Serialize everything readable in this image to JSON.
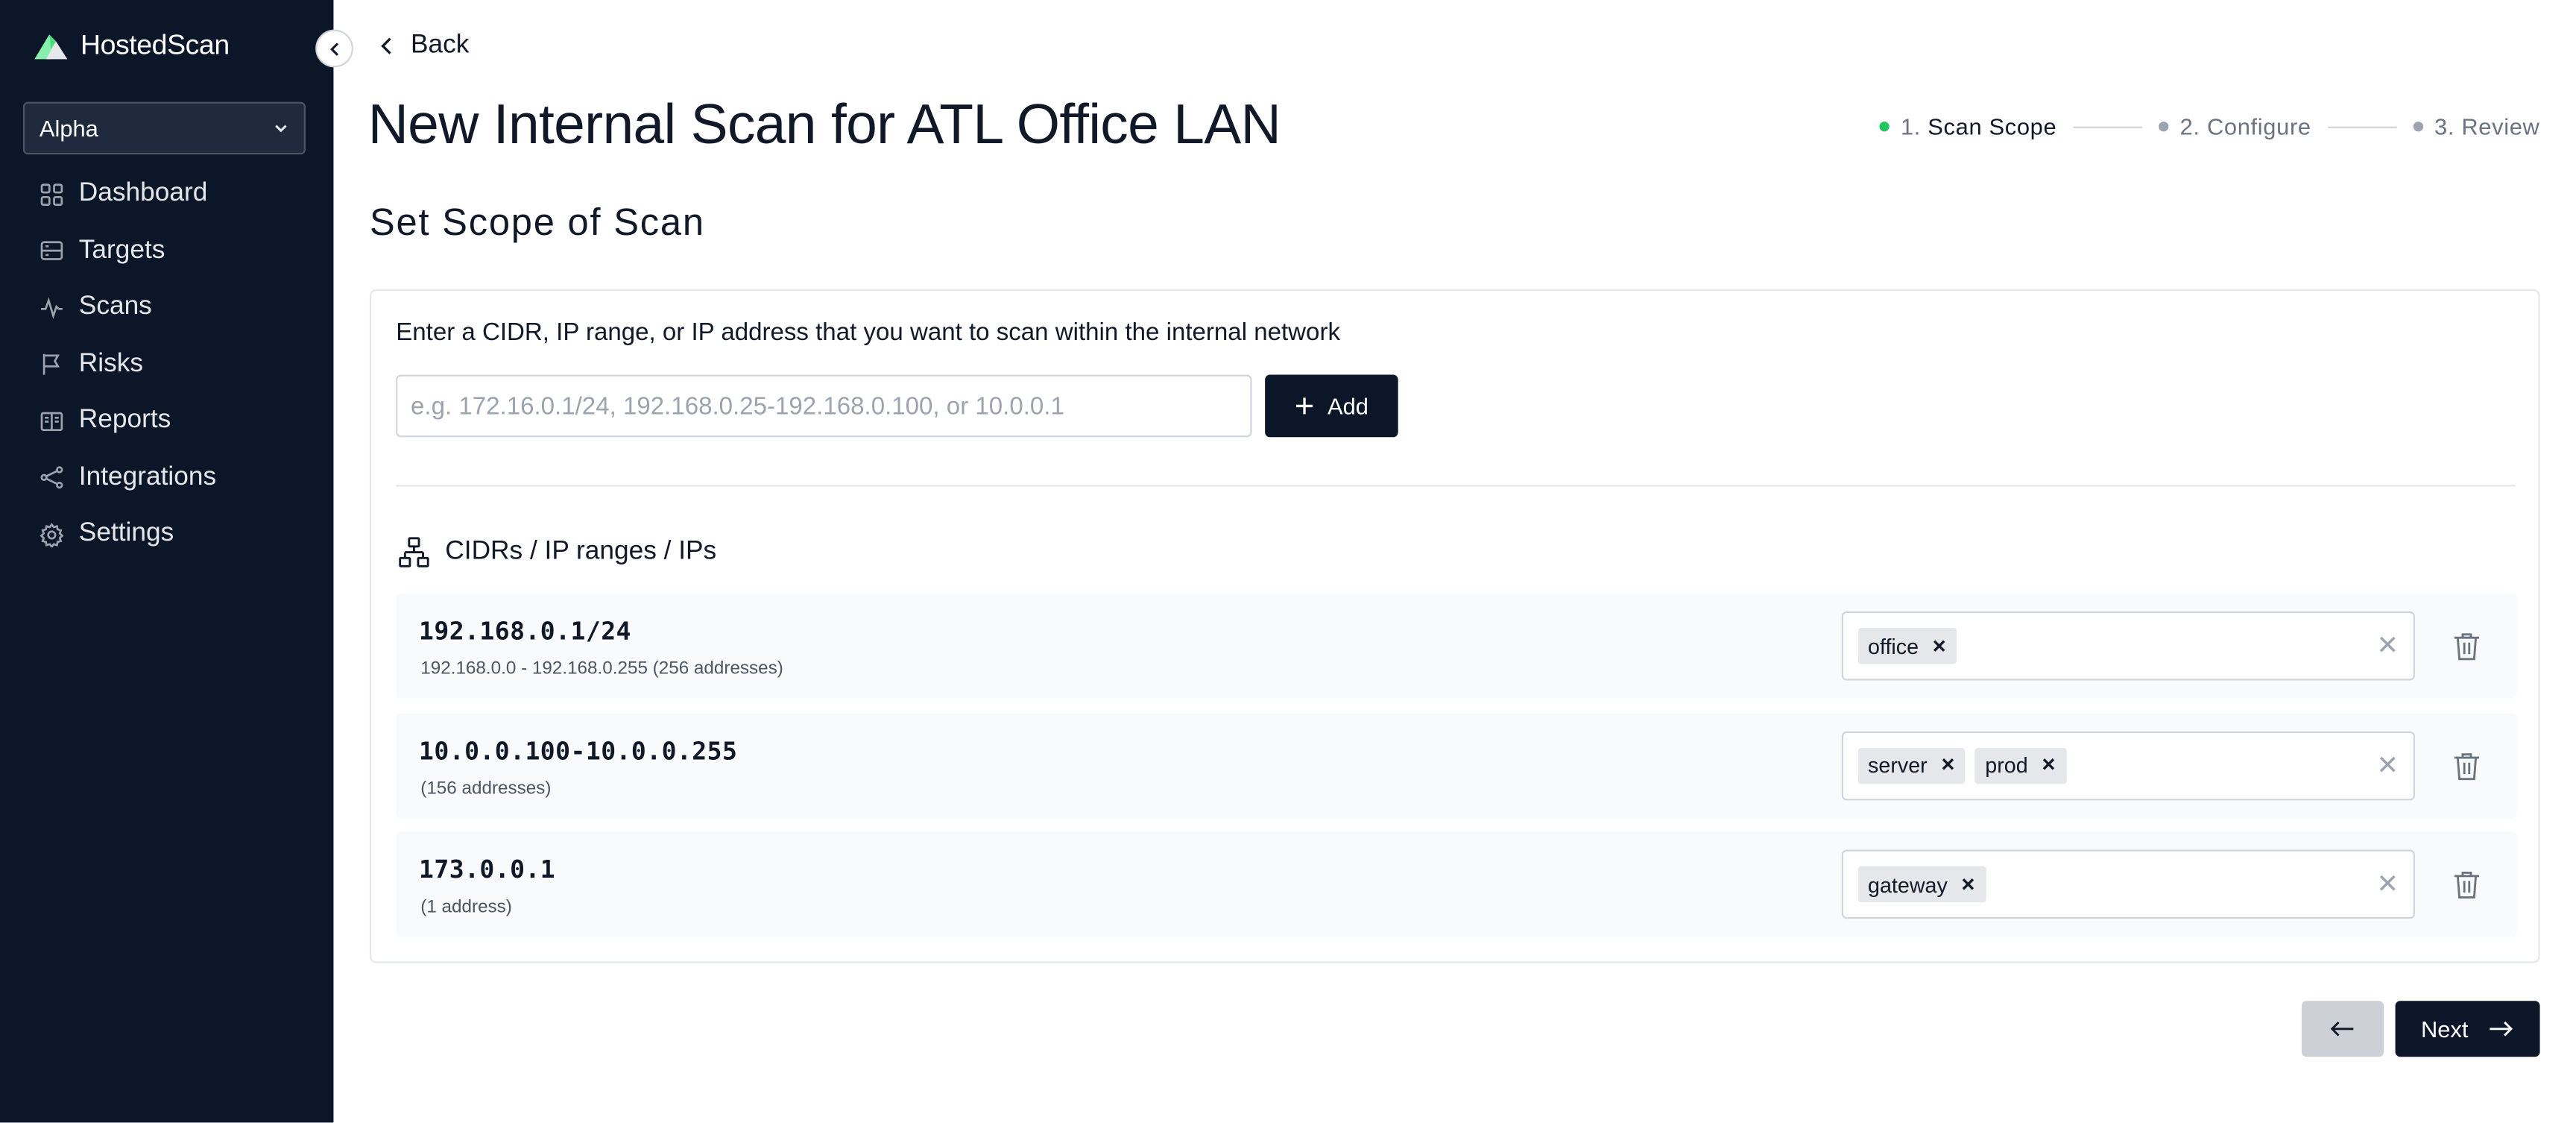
{
  "app": {
    "name": "HostedScan",
    "org": "Alpha"
  },
  "sidebar": {
    "items": [
      {
        "label": "Dashboard",
        "icon": "grid-icon"
      },
      {
        "label": "Targets",
        "icon": "server-icon"
      },
      {
        "label": "Scans",
        "icon": "activity-icon"
      },
      {
        "label": "Risks",
        "icon": "flag-icon"
      },
      {
        "label": "Reports",
        "icon": "book-icon"
      },
      {
        "label": "Integrations",
        "icon": "share-icon"
      },
      {
        "label": "Settings",
        "icon": "gear-icon"
      }
    ]
  },
  "header": {
    "back_label": "Back",
    "title": "New Internal Scan for ATL Office LAN"
  },
  "stepper": {
    "steps": [
      {
        "num": "1.",
        "label": "Scan Scope",
        "active": true
      },
      {
        "num": "2.",
        "label": "Configure",
        "active": false
      },
      {
        "num": "3.",
        "label": "Review",
        "active": false
      }
    ]
  },
  "scope": {
    "section_title": "Set Scope of Scan",
    "instructions": "Enter a CIDR, IP range, or IP address that you want to scan within the internal network",
    "input_value": "",
    "input_placeholder": "e.g. 172.16.0.1/24, 192.168.0.25-192.168.0.100, or 10.0.0.1",
    "add_label": "Add",
    "list_heading": "CIDRs / IP ranges / IPs",
    "rows": [
      {
        "address": "192.168.0.1/24",
        "range": "192.168.0.0 - 192.168.0.255 (256 addresses)",
        "tags": [
          "office"
        ]
      },
      {
        "address": "10.0.0.100-10.0.0.255",
        "range": "(156 addresses)",
        "tags": [
          "server",
          "prod"
        ]
      },
      {
        "address": "173.0.0.1",
        "range": "(1 address)",
        "tags": [
          "gateway"
        ]
      }
    ]
  },
  "footer": {
    "next_label": "Next"
  },
  "colors": {
    "sidebar_bg": "#0c1629",
    "primary_button": "#0c1629",
    "active_step_dot": "#22c55e",
    "disabled_button": "#cdd0d6"
  }
}
